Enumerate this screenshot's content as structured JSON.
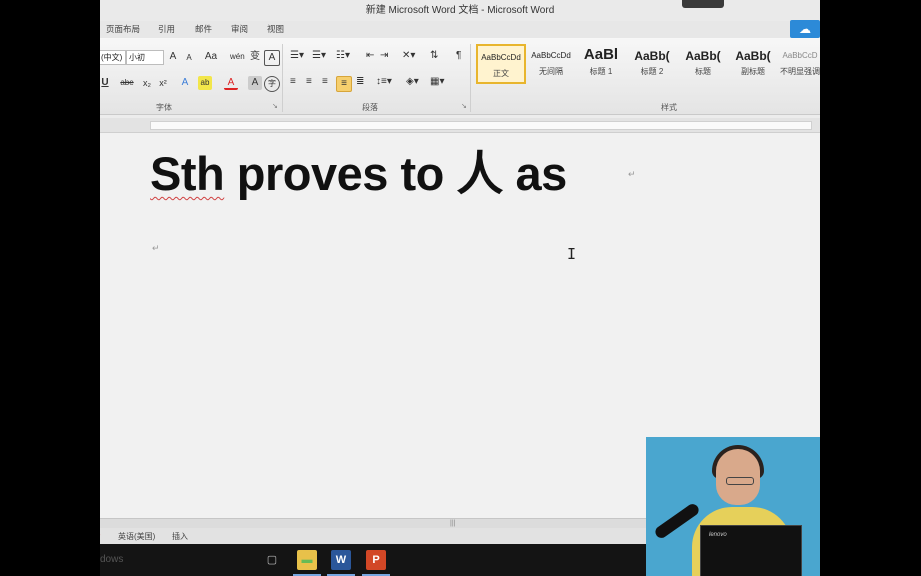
{
  "window": {
    "title": "新建 Microsoft Word 文档 - Microsoft Word"
  },
  "ribbon_tabs": [
    "页面布局",
    "引用",
    "邮件",
    "审阅",
    "视图"
  ],
  "font_group": {
    "font_name": "(中文)",
    "font_size": "小初",
    "label": "字体",
    "buttons": [
      "A",
      "A",
      "Aa",
      "wén",
      "变",
      "A",
      "U",
      "abe",
      "x₂",
      "x²",
      "A",
      "ab",
      "A",
      "A",
      "字"
    ]
  },
  "paragraph_group": {
    "label": "段落"
  },
  "styles_group": {
    "label": "样式",
    "styles": [
      {
        "sample": "AaBbCcDd",
        "name": "正文",
        "size": "small",
        "selected": true
      },
      {
        "sample": "AaBbCcDd",
        "name": "无间隔",
        "size": "small",
        "selected": false
      },
      {
        "sample": "AaBl",
        "name": "标题 1",
        "size": "big",
        "selected": false
      },
      {
        "sample": "AaBb(",
        "name": "标题 2",
        "size": "med",
        "selected": false
      },
      {
        "sample": "AaBb(",
        "name": "标题",
        "size": "med",
        "selected": false
      },
      {
        "sample": "AaBb(",
        "name": "副标题",
        "size": "med",
        "selected": false
      },
      {
        "sample": "AaBbCcD",
        "name": "不明显强调",
        "size": "small",
        "selected": false
      }
    ]
  },
  "document": {
    "heading_word1": "Sth",
    "heading_rest": " proves to 人 as",
    "para_mark": "↵",
    "cursor_glyph": "I"
  },
  "status_bar": {
    "language": "英语(美国)",
    "mode": "插入"
  },
  "taskbar": {
    "ghost_text": "dows",
    "apps": [
      {
        "name": "task-view",
        "glyph": "▢"
      },
      {
        "name": "file-explorer",
        "glyph": "▬"
      },
      {
        "name": "word",
        "glyph": "W"
      },
      {
        "name": "powerpoint",
        "glyph": "P"
      }
    ]
  },
  "webcam": {
    "laptop_brand": "lenovo"
  },
  "colors": {
    "word_blue": "#2b579a",
    "ppt_orange": "#d24726",
    "selected_style": "#e8b52d"
  }
}
